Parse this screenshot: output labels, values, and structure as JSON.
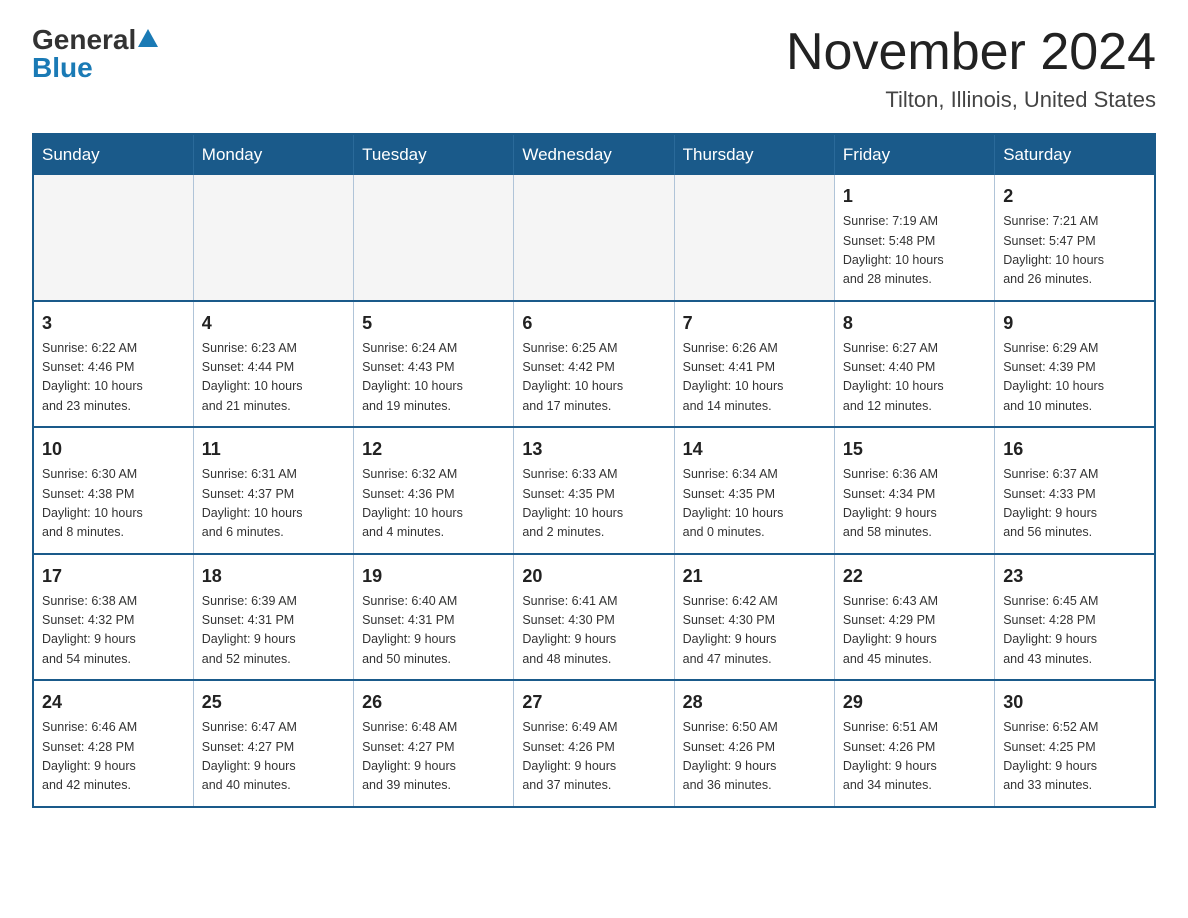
{
  "header": {
    "logo_general": "General",
    "logo_blue": "Blue",
    "month_title": "November 2024",
    "location": "Tilton, Illinois, United States"
  },
  "calendar": {
    "days_of_week": [
      "Sunday",
      "Monday",
      "Tuesday",
      "Wednesday",
      "Thursday",
      "Friday",
      "Saturday"
    ],
    "weeks": [
      [
        {
          "day": "",
          "info": ""
        },
        {
          "day": "",
          "info": ""
        },
        {
          "day": "",
          "info": ""
        },
        {
          "day": "",
          "info": ""
        },
        {
          "day": "",
          "info": ""
        },
        {
          "day": "1",
          "info": "Sunrise: 7:19 AM\nSunset: 5:48 PM\nDaylight: 10 hours\nand 28 minutes."
        },
        {
          "day": "2",
          "info": "Sunrise: 7:21 AM\nSunset: 5:47 PM\nDaylight: 10 hours\nand 26 minutes."
        }
      ],
      [
        {
          "day": "3",
          "info": "Sunrise: 6:22 AM\nSunset: 4:46 PM\nDaylight: 10 hours\nand 23 minutes."
        },
        {
          "day": "4",
          "info": "Sunrise: 6:23 AM\nSunset: 4:44 PM\nDaylight: 10 hours\nand 21 minutes."
        },
        {
          "day": "5",
          "info": "Sunrise: 6:24 AM\nSunset: 4:43 PM\nDaylight: 10 hours\nand 19 minutes."
        },
        {
          "day": "6",
          "info": "Sunrise: 6:25 AM\nSunset: 4:42 PM\nDaylight: 10 hours\nand 17 minutes."
        },
        {
          "day": "7",
          "info": "Sunrise: 6:26 AM\nSunset: 4:41 PM\nDaylight: 10 hours\nand 14 minutes."
        },
        {
          "day": "8",
          "info": "Sunrise: 6:27 AM\nSunset: 4:40 PM\nDaylight: 10 hours\nand 12 minutes."
        },
        {
          "day": "9",
          "info": "Sunrise: 6:29 AM\nSunset: 4:39 PM\nDaylight: 10 hours\nand 10 minutes."
        }
      ],
      [
        {
          "day": "10",
          "info": "Sunrise: 6:30 AM\nSunset: 4:38 PM\nDaylight: 10 hours\nand 8 minutes."
        },
        {
          "day": "11",
          "info": "Sunrise: 6:31 AM\nSunset: 4:37 PM\nDaylight: 10 hours\nand 6 minutes."
        },
        {
          "day": "12",
          "info": "Sunrise: 6:32 AM\nSunset: 4:36 PM\nDaylight: 10 hours\nand 4 minutes."
        },
        {
          "day": "13",
          "info": "Sunrise: 6:33 AM\nSunset: 4:35 PM\nDaylight: 10 hours\nand 2 minutes."
        },
        {
          "day": "14",
          "info": "Sunrise: 6:34 AM\nSunset: 4:35 PM\nDaylight: 10 hours\nand 0 minutes."
        },
        {
          "day": "15",
          "info": "Sunrise: 6:36 AM\nSunset: 4:34 PM\nDaylight: 9 hours\nand 58 minutes."
        },
        {
          "day": "16",
          "info": "Sunrise: 6:37 AM\nSunset: 4:33 PM\nDaylight: 9 hours\nand 56 minutes."
        }
      ],
      [
        {
          "day": "17",
          "info": "Sunrise: 6:38 AM\nSunset: 4:32 PM\nDaylight: 9 hours\nand 54 minutes."
        },
        {
          "day": "18",
          "info": "Sunrise: 6:39 AM\nSunset: 4:31 PM\nDaylight: 9 hours\nand 52 minutes."
        },
        {
          "day": "19",
          "info": "Sunrise: 6:40 AM\nSunset: 4:31 PM\nDaylight: 9 hours\nand 50 minutes."
        },
        {
          "day": "20",
          "info": "Sunrise: 6:41 AM\nSunset: 4:30 PM\nDaylight: 9 hours\nand 48 minutes."
        },
        {
          "day": "21",
          "info": "Sunrise: 6:42 AM\nSunset: 4:30 PM\nDaylight: 9 hours\nand 47 minutes."
        },
        {
          "day": "22",
          "info": "Sunrise: 6:43 AM\nSunset: 4:29 PM\nDaylight: 9 hours\nand 45 minutes."
        },
        {
          "day": "23",
          "info": "Sunrise: 6:45 AM\nSunset: 4:28 PM\nDaylight: 9 hours\nand 43 minutes."
        }
      ],
      [
        {
          "day": "24",
          "info": "Sunrise: 6:46 AM\nSunset: 4:28 PM\nDaylight: 9 hours\nand 42 minutes."
        },
        {
          "day": "25",
          "info": "Sunrise: 6:47 AM\nSunset: 4:27 PM\nDaylight: 9 hours\nand 40 minutes."
        },
        {
          "day": "26",
          "info": "Sunrise: 6:48 AM\nSunset: 4:27 PM\nDaylight: 9 hours\nand 39 minutes."
        },
        {
          "day": "27",
          "info": "Sunrise: 6:49 AM\nSunset: 4:26 PM\nDaylight: 9 hours\nand 37 minutes."
        },
        {
          "day": "28",
          "info": "Sunrise: 6:50 AM\nSunset: 4:26 PM\nDaylight: 9 hours\nand 36 minutes."
        },
        {
          "day": "29",
          "info": "Sunrise: 6:51 AM\nSunset: 4:26 PM\nDaylight: 9 hours\nand 34 minutes."
        },
        {
          "day": "30",
          "info": "Sunrise: 6:52 AM\nSunset: 4:25 PM\nDaylight: 9 hours\nand 33 minutes."
        }
      ]
    ]
  }
}
